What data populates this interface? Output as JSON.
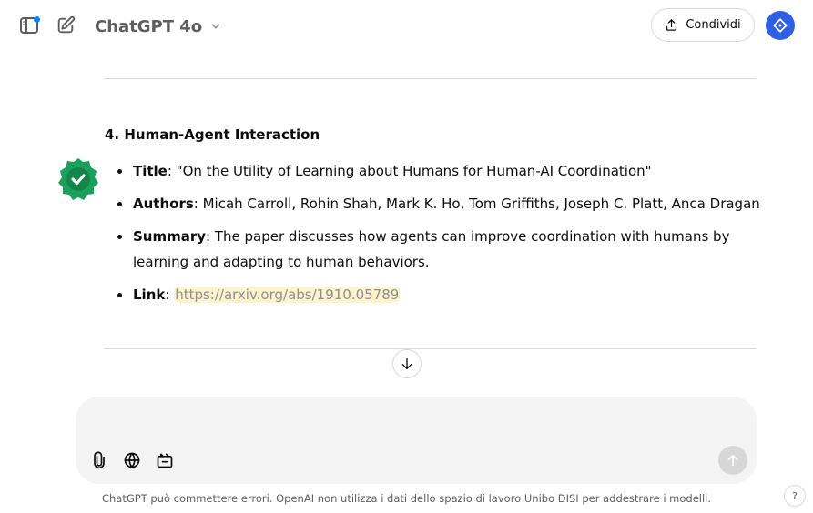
{
  "header": {
    "model_name": "ChatGPT 4o",
    "share_label": "Condividi",
    "icons": {
      "sidebar": "sidebar-toggle-icon",
      "new_chat": "new-chat-icon",
      "model_dropdown": "chevron-down-icon",
      "share": "share-icon",
      "profile": "profile-icon"
    }
  },
  "message": {
    "section_title": "4. Human-Agent Interaction",
    "badge_icon": "verified-check-icon",
    "badge_color": "#19a05a",
    "items": {
      "title": {
        "label": "Title",
        "value": ": \"On the Utility of Learning about Humans for Human-AI Coordination\""
      },
      "authors": {
        "label": "Authors",
        "value": ": Micah Carroll, Rohin Shah, Mark K. Ho, Tom Griffiths, Joseph C. Platt, Anca Dragan"
      },
      "summary": {
        "label": "Summary",
        "value": ": The paper discusses how agents can improve coordination with humans by learning and adapting to human behaviors."
      },
      "link": {
        "label": "Link",
        "separator": ": ",
        "url": "https://arxiv.org/abs/1910.05789"
      }
    }
  },
  "composer": {
    "placeholder": "",
    "tools": [
      "attach-icon",
      "globe-icon",
      "canvas-icon"
    ],
    "send_icon": "arrow-up-icon"
  },
  "footer": {
    "disclaimer": "ChatGPT può commettere errori. OpenAI non utilizza i dati dello spazio di lavoro Unibo DISI per addestrare i modelli.",
    "help_label": "?"
  },
  "colors": {
    "accent": "#2e5fe6",
    "notification_dot": "#0285ff",
    "link_highlight": "#fdf3cf"
  }
}
